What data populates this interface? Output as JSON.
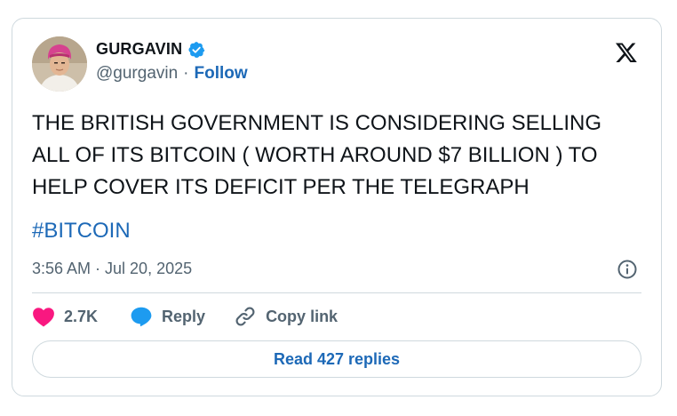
{
  "author": {
    "name": "GURGAVIN",
    "handle": "@gurgavin",
    "separator": "·",
    "follow_label": "Follow",
    "verified_icon": "verified-badge-icon"
  },
  "tweet": {
    "text": "THE BRITISH GOVERNMENT IS CONSIDERING SELLING ALL OF ITS BITCOIN ( WORTH AROUND $7 BILLION ) TO HELP COVER ITS DEFICIT PER THE TELEGRAPH",
    "hashtag": "#BITCOIN",
    "timestamp": "3:56 AM · Jul 20, 2025"
  },
  "actions": {
    "likes_count": "2.7K",
    "reply_label": "Reply",
    "copy_link_label": "Copy link",
    "read_replies_label": "Read 427 replies"
  },
  "colors": {
    "accent": "#1d69b7",
    "verified": "#1d9bf0",
    "like": "#f91880",
    "text": "#0f1419",
    "muted": "#536471",
    "border": "#cfd9de"
  }
}
